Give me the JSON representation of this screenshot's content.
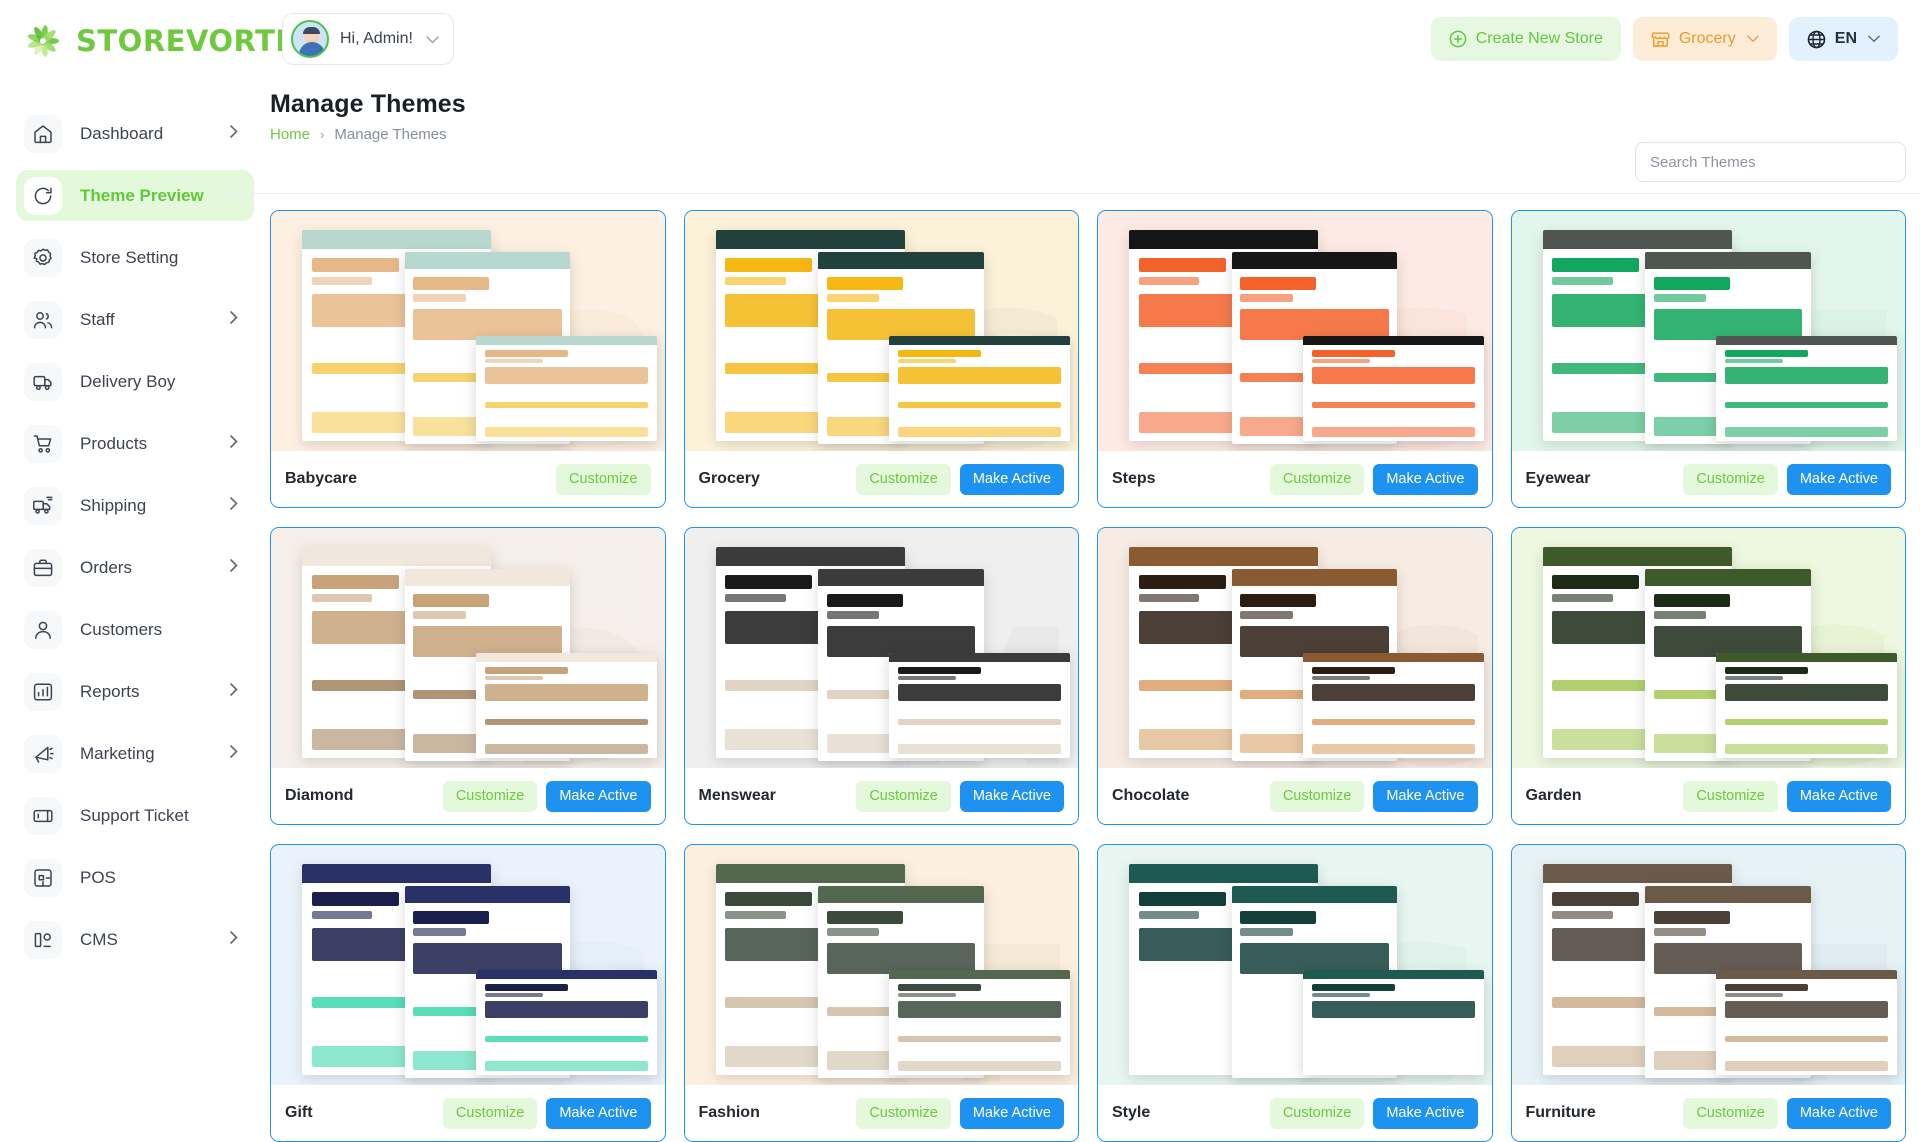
{
  "brand": {
    "name": "STOREVORTEX",
    "logo_icon": "vortex-logo-icon",
    "accent": "#6fc93f"
  },
  "header": {
    "user_greeting": "Hi, Admin!",
    "user_caret_icon": "chevron-down-icon",
    "avatar_icon": "user-avatar",
    "actions": [
      {
        "id": "create-store",
        "label": "Create New Store",
        "icon": "plus-circle-icon",
        "bg": "#e7f8e2",
        "fg": "#61c83c"
      },
      {
        "id": "store-select",
        "label": "Grocery",
        "icon": "store-icon",
        "caret": "chevron-down-icon",
        "bg": "#fdecd7",
        "fg": "#f0991f"
      },
      {
        "id": "language-select",
        "label": "EN",
        "icon": "globe-icon",
        "caret": "chevron-down-icon",
        "bg": "#e2f1fd",
        "fg": "#24303f"
      }
    ]
  },
  "sidebar": {
    "items": [
      {
        "label": "Dashboard",
        "icon": "home-icon",
        "chevron": true,
        "active": false
      },
      {
        "label": "Theme Preview",
        "icon": "refresh-icon",
        "chevron": false,
        "active": true
      },
      {
        "label": "Store Setting",
        "icon": "settings-gear-icon",
        "chevron": false,
        "active": false
      },
      {
        "label": "Staff",
        "icon": "users-icon",
        "chevron": true,
        "active": false
      },
      {
        "label": "Delivery Boy",
        "icon": "truck-icon",
        "chevron": false,
        "active": false
      },
      {
        "label": "Products",
        "icon": "cart-icon",
        "chevron": true,
        "active": false
      },
      {
        "label": "Shipping",
        "icon": "shipping-truck-icon",
        "chevron": true,
        "active": false
      },
      {
        "label": "Orders",
        "icon": "briefcase-icon",
        "chevron": true,
        "active": false
      },
      {
        "label": "Customers",
        "icon": "user-icon",
        "chevron": false,
        "active": false
      },
      {
        "label": "Reports",
        "icon": "bar-chart-icon",
        "chevron": true,
        "active": false
      },
      {
        "label": "Marketing",
        "icon": "megaphone-icon",
        "chevron": true,
        "active": false
      },
      {
        "label": "Support Ticket",
        "icon": "ticket-icon",
        "chevron": false,
        "active": false
      },
      {
        "label": "POS",
        "icon": "pos-terminal-icon",
        "chevron": false,
        "active": false
      },
      {
        "label": "CMS",
        "icon": "cms-icon",
        "chevron": true,
        "active": false
      }
    ]
  },
  "page": {
    "title": "Manage Themes",
    "breadcrumb": {
      "home": "Home",
      "separator": "›",
      "current": "Manage Themes"
    }
  },
  "search": {
    "placeholder": "Search Themes",
    "value": ""
  },
  "buttons": {
    "customize": "Customize",
    "make_active": "Make Active"
  },
  "colors": {
    "card_border": "#1e92f0",
    "make_active_bg": "#1e92f0",
    "customize_bg": "#e4f8dc",
    "customize_fg": "#6dc93f"
  },
  "themes": [
    {
      "name": "Babycare",
      "watermark": "B",
      "customize": true,
      "make_active": false,
      "bg": "#fdf0e2",
      "wm_color": "#f4dcbe",
      "c1": "#e7b887",
      "c2": "#b8d8cf",
      "c3": "#f4c84a",
      "c4": "#ffffff",
      "c5": "#3d4350"
    },
    {
      "name": "Grocery",
      "watermark": "G",
      "customize": true,
      "make_active": true,
      "bg": "#fbf2d9",
      "wm_color": "#d8d4c2",
      "c1": "#f5b712",
      "c2": "#22413c",
      "c3": "#f5b712",
      "c4": "#ffffff",
      "c5": "#22413c"
    },
    {
      "name": "Steps",
      "watermark": "S",
      "customize": true,
      "make_active": true,
      "bg": "#fdeae4",
      "wm_color": "#f6cdbd",
      "c1": "#f4622b",
      "c2": "#161616",
      "c3": "#f4622b",
      "c4": "#ffffff",
      "c5": "#161616"
    },
    {
      "name": "Eyewear",
      "watermark": "E",
      "customize": true,
      "make_active": true,
      "bg": "#e3f6ec",
      "wm_color": "#bfe8d2",
      "c1": "#11a75c",
      "c2": "#4f5651",
      "c3": "#11a75c",
      "c4": "#ffffff",
      "c5": "#4f5651"
    },
    {
      "name": "Diamond",
      "watermark": "D",
      "customize": true,
      "make_active": true,
      "bg": "#f6efe9",
      "wm_color": "#ded2c7",
      "c1": "#c8a37a",
      "c2": "#f1e7dd",
      "c3": "#9c7b55",
      "c4": "#ffffff",
      "c5": "#4a3d31"
    },
    {
      "name": "Menswear",
      "watermark": "M",
      "customize": true,
      "make_active": true,
      "bg": "#efefef",
      "wm_color": "#cfcfcf",
      "c1": "#1a1a1a",
      "c2": "#3b3b3b",
      "c3": "#d9c9b5",
      "c4": "#ffffff",
      "c5": "#121212"
    },
    {
      "name": "Chocolate",
      "watermark": "C",
      "customize": true,
      "make_active": true,
      "bg": "#f7ece3",
      "wm_color": "#e1cdbc",
      "c1": "#2b1d14",
      "c2": "#8a5a32",
      "c3": "#d79a5b",
      "c4": "#ffffff",
      "c5": "#1c120b"
    },
    {
      "name": "Garden",
      "watermark": "G",
      "customize": true,
      "make_active": true,
      "bg": "#eef7e0",
      "wm_color": "#cfe3ad",
      "c1": "#1d2b17",
      "c2": "#3f5a2a",
      "c3": "#9fc54a",
      "c4": "#ffffff",
      "c5": "#16210f"
    },
    {
      "name": "Gift",
      "watermark": "G",
      "customize": true,
      "make_active": true,
      "bg": "#eaf3fb",
      "wm_color": "#cfe0ee",
      "c1": "#1b1f4b",
      "c2": "#2a3166",
      "c3": "#2fd6a8",
      "c4": "#ffffff",
      "c5": "#10133a"
    },
    {
      "name": "Fashion",
      "watermark": "F",
      "customize": true,
      "make_active": true,
      "bg": "#fcefdf",
      "wm_color": "#e7d2b8",
      "c1": "#3b4a3d",
      "c2": "#54684f",
      "c3": "#c9b89c",
      "c4": "#ffffff",
      "c5": "#2b362c"
    },
    {
      "name": "Style",
      "watermark": "S",
      "customize": true,
      "make_active": true,
      "bg": "#e8f6f2",
      "wm_color": "#c6e5dc",
      "c1": "#14403c",
      "c2": "#1f5a52",
      "c3": "#ffffff",
      "c4": "#ffffff",
      "c5": "#0e2e2b"
    },
    {
      "name": "Furniture",
      "watermark": "F",
      "customize": true,
      "make_active": true,
      "bg": "#e6f2f6",
      "wm_color": "#c7dee6",
      "c1": "#4a4037",
      "c2": "#6b5a49",
      "c3": "#c9a886",
      "c4": "#ffffff",
      "c5": "#2e261f"
    }
  ]
}
